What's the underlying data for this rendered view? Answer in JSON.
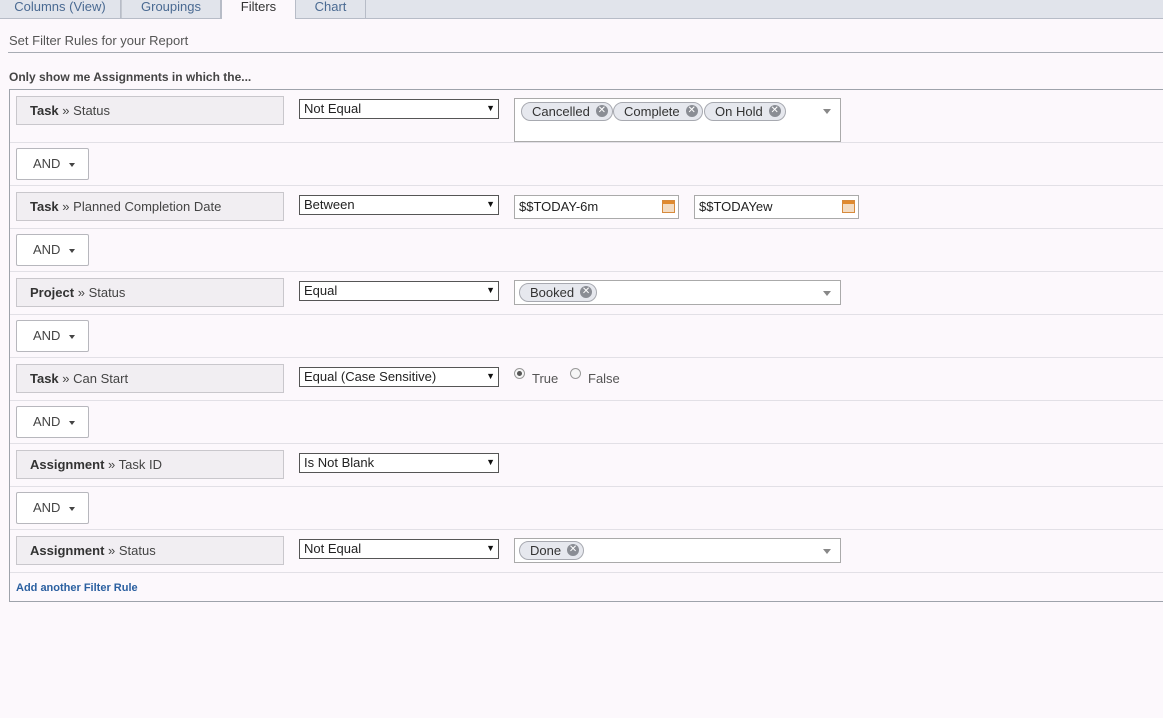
{
  "tabs": [
    {
      "label": "Columns (View)"
    },
    {
      "label": "Groupings"
    },
    {
      "label": "Filters"
    },
    {
      "label": "Chart"
    }
  ],
  "section_title": "Set Filter Rules for your Report",
  "intro": "Only show me Assignments in which the...",
  "rules": [
    {
      "object": "Task",
      "field": "Status",
      "operator": "Not Equal",
      "values": [
        "Cancelled",
        "Complete",
        "On Hold"
      ]
    },
    {
      "object": "Task",
      "field": "Planned Completion Date",
      "operator": "Between",
      "date_from": "$$TODAY-6m",
      "date_to": "$$TODAYew"
    },
    {
      "object": "Project",
      "field": "Status",
      "operator": "Equal",
      "values": [
        "Booked"
      ]
    },
    {
      "object": "Task",
      "field": "Can Start",
      "operator": "Equal (Case Sensitive)",
      "true_label": "True",
      "false_label": "False",
      "selected": "True"
    },
    {
      "object": "Assignment",
      "field": "Task ID",
      "operator": "Is Not Blank"
    },
    {
      "object": "Assignment",
      "field": "Status",
      "operator": "Not Equal",
      "values": [
        "Done"
      ]
    }
  ],
  "connector_label": "AND",
  "separator": "»",
  "add_rule_label": "Add another Filter Rule",
  "colors": {
    "link": "#2a5fa0",
    "tab_text": "#4a6a92",
    "panel_border": "#9ea3ab"
  }
}
